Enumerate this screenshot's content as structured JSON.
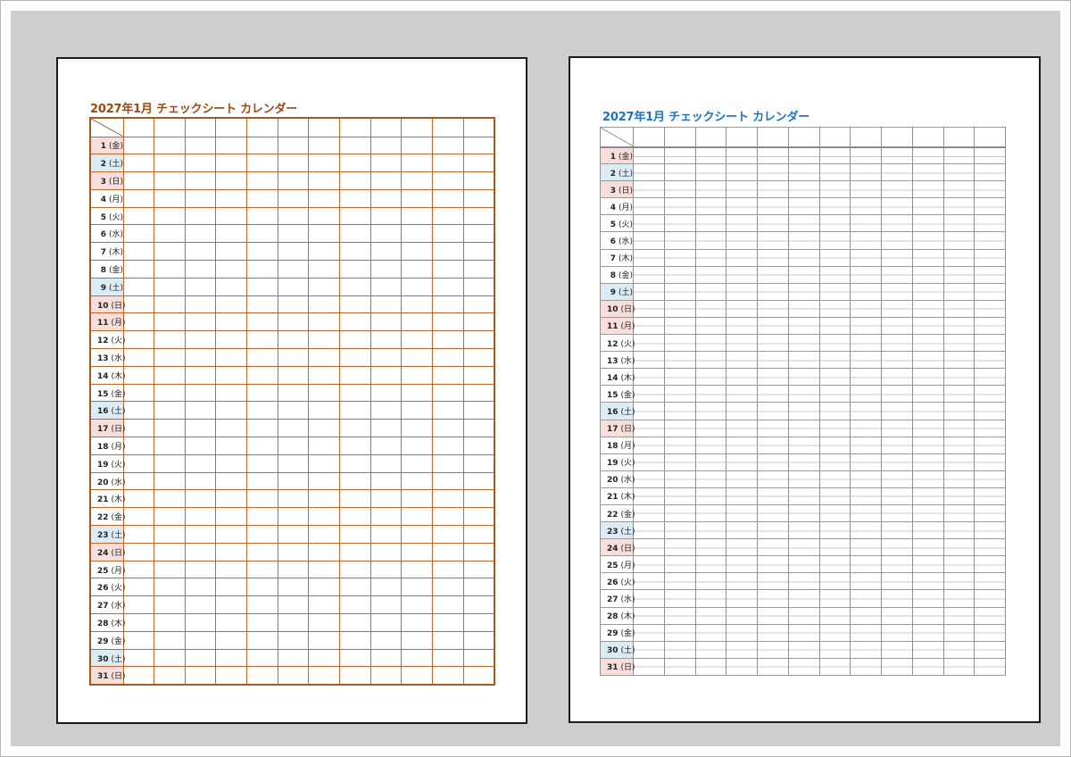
{
  "pages": [
    {
      "title": "2027年1月 チェックシート カレンダー",
      "style": "orange",
      "title_color": "#9b4a12",
      "grid_color": "#c0682c"
    },
    {
      "title": "2027年1月 チェックシート カレンダー",
      "style": "grey",
      "title_color": "#1d74c4",
      "grid_color": "#8f8f8f"
    }
  ],
  "check_columns": 12,
  "colors": {
    "saturday_bg": "#dcecf4",
    "sunday_bg": "#f7dedb"
  },
  "days": [
    {
      "d": "1",
      "w": "(金)",
      "type": "holiday"
    },
    {
      "d": "2",
      "w": "(土)",
      "type": "sat"
    },
    {
      "d": "3",
      "w": "(日)",
      "type": "sun"
    },
    {
      "d": "4",
      "w": "(月)",
      "type": "weekday"
    },
    {
      "d": "5",
      "w": "(火)",
      "type": "weekday"
    },
    {
      "d": "6",
      "w": "(水)",
      "type": "weekday"
    },
    {
      "d": "7",
      "w": "(木)",
      "type": "weekday"
    },
    {
      "d": "8",
      "w": "(金)",
      "type": "weekday"
    },
    {
      "d": "9",
      "w": "(土)",
      "type": "sat"
    },
    {
      "d": "10",
      "w": "(日)",
      "type": "sun"
    },
    {
      "d": "11",
      "w": "(月)",
      "type": "holiday"
    },
    {
      "d": "12",
      "w": "(火)",
      "type": "weekday"
    },
    {
      "d": "13",
      "w": "(水)",
      "type": "weekday"
    },
    {
      "d": "14",
      "w": "(木)",
      "type": "weekday"
    },
    {
      "d": "15",
      "w": "(金)",
      "type": "weekday"
    },
    {
      "d": "16",
      "w": "(土)",
      "type": "sat"
    },
    {
      "d": "17",
      "w": "(日)",
      "type": "sun"
    },
    {
      "d": "18",
      "w": "(月)",
      "type": "weekday"
    },
    {
      "d": "19",
      "w": "(火)",
      "type": "weekday"
    },
    {
      "d": "20",
      "w": "(水)",
      "type": "weekday"
    },
    {
      "d": "21",
      "w": "(木)",
      "type": "weekday"
    },
    {
      "d": "22",
      "w": "(金)",
      "type": "weekday"
    },
    {
      "d": "23",
      "w": "(土)",
      "type": "sat"
    },
    {
      "d": "24",
      "w": "(日)",
      "type": "sun"
    },
    {
      "d": "25",
      "w": "(月)",
      "type": "weekday"
    },
    {
      "d": "26",
      "w": "(火)",
      "type": "weekday"
    },
    {
      "d": "27",
      "w": "(水)",
      "type": "weekday"
    },
    {
      "d": "28",
      "w": "(木)",
      "type": "weekday"
    },
    {
      "d": "29",
      "w": "(金)",
      "type": "weekday"
    },
    {
      "d": "30",
      "w": "(土)",
      "type": "sat"
    },
    {
      "d": "31",
      "w": "(日)",
      "type": "sun"
    }
  ]
}
